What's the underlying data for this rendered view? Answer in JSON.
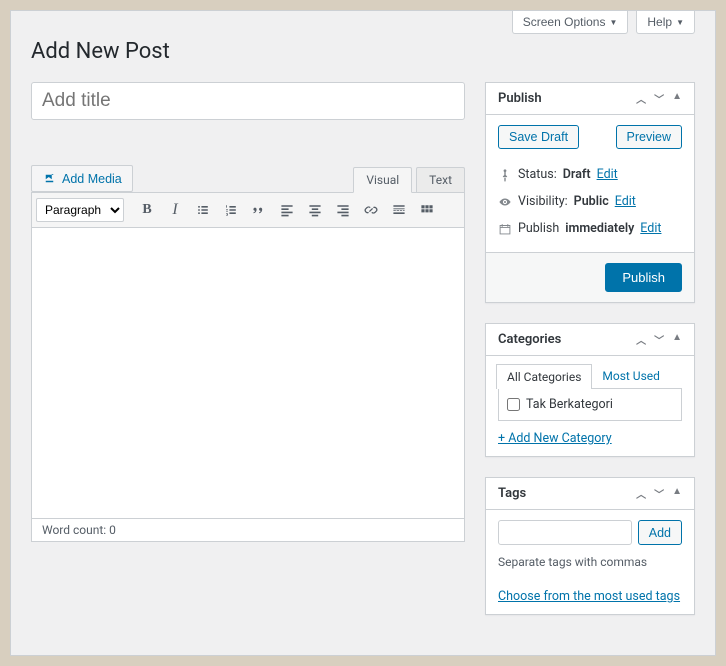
{
  "screen_meta": {
    "screen_options": "Screen Options",
    "help": "Help"
  },
  "page_title": "Add New Post",
  "title_placeholder": "Add title",
  "add_media_label": "Add Media",
  "editor": {
    "tabs": {
      "visual": "Visual",
      "text": "Text"
    },
    "format_select": "Paragraph",
    "wordcount_label": "Word count: 0"
  },
  "publish": {
    "heading": "Publish",
    "save_draft": "Save Draft",
    "preview": "Preview",
    "status_label": "Status:",
    "status_value": "Draft",
    "visibility_label": "Visibility:",
    "visibility_value": "Public",
    "publish_label": "Publish",
    "publish_value": "immediately",
    "edit_label": "Edit",
    "publish_button": "Publish"
  },
  "categories": {
    "heading": "Categories",
    "tab_all": "All Categories",
    "tab_most": "Most Used",
    "item": "Tak Berkategori",
    "add_new": "+ Add New Category"
  },
  "tags": {
    "heading": "Tags",
    "add_button": "Add",
    "hint": "Separate tags with commas",
    "choose_link": "Choose from the most used tags"
  }
}
